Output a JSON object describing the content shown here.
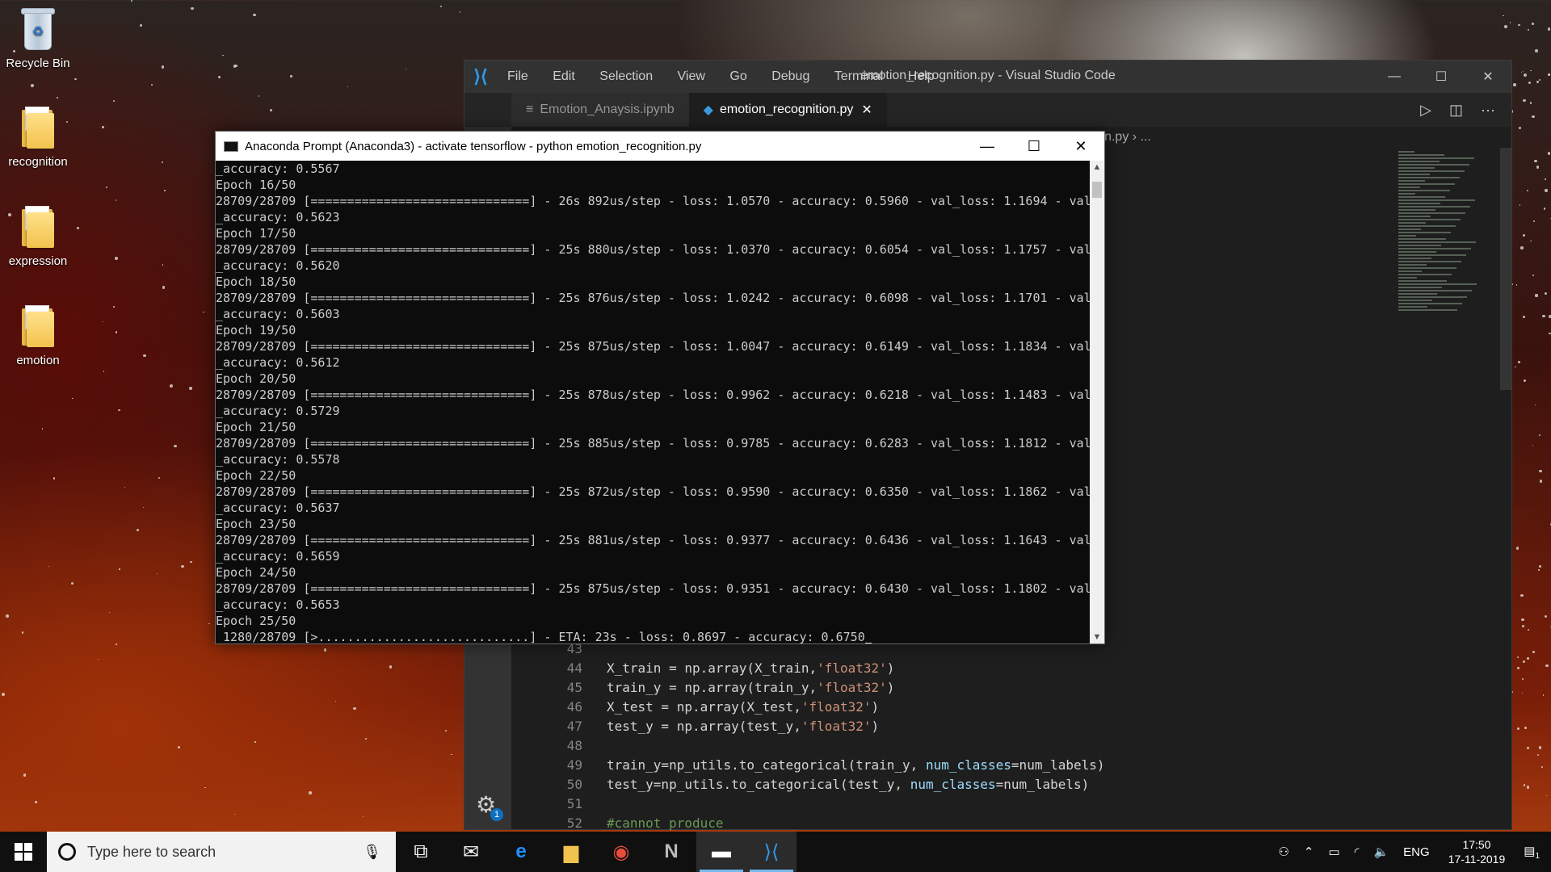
{
  "desktop": {
    "icons": [
      {
        "label": "Recycle Bin"
      },
      {
        "label": "recognition"
      },
      {
        "label": "expression"
      },
      {
        "label": "emotion"
      }
    ]
  },
  "vscode": {
    "menu": [
      "File",
      "Edit",
      "Selection",
      "View",
      "Go",
      "Debug",
      "Terminal",
      "Help"
    ],
    "window_title": "emotion_recognition.py - Visual Studio Code",
    "tabs": [
      {
        "label": "Emotion_Anaysis.ipynb",
        "icon": "notebook-icon"
      },
      {
        "label": "emotion_recognition.py",
        "icon": "python-icon",
        "close": "✕"
      }
    ],
    "breadcrumb": "tion_recognition.py  ›  ...",
    "code_lines": [
      {
        "n": "43",
        "t": ""
      },
      {
        "n": "44",
        "a": "X_train = np.array(X_train,",
        "s": "'float32'",
        "b": ")"
      },
      {
        "n": "45",
        "a": "train_y = np.array(train_y,",
        "s": "'float32'",
        "b": ")"
      },
      {
        "n": "46",
        "a": "X_test = np.array(X_test,",
        "s": "'float32'",
        "b": ")"
      },
      {
        "n": "47",
        "a": "test_y = np.array(test_y,",
        "s": "'float32'",
        "b": ")"
      },
      {
        "n": "48",
        "t": ""
      },
      {
        "n": "49",
        "a": "train_y=np_utils.to_categorical(train_y, ",
        "k": "num_classes",
        "b": "=num_labels)"
      },
      {
        "n": "50",
        "a": "test_y=np_utils.to_categorical(test_y, ",
        "k": "num_classes",
        "b": "=num_labels)"
      },
      {
        "n": "51",
        "t": ""
      },
      {
        "n": "52",
        "c": "#cannot produce"
      }
    ],
    "settings_badge": "1"
  },
  "prompt": {
    "title": "Anaconda Prompt (Anaconda3) - activate  tensorflow - python  emotion_recognition.py",
    "lines": [
      "_accuracy: 0.5567",
      "Epoch 16/50",
      "28709/28709 [==============================] - 26s 892us/step - loss: 1.0570 - accuracy: 0.5960 - val_loss: 1.1694 - val",
      "_accuracy: 0.5623",
      "Epoch 17/50",
      "28709/28709 [==============================] - 25s 880us/step - loss: 1.0370 - accuracy: 0.6054 - val_loss: 1.1757 - val",
      "_accuracy: 0.5620",
      "Epoch 18/50",
      "28709/28709 [==============================] - 25s 876us/step - loss: 1.0242 - accuracy: 0.6098 - val_loss: 1.1701 - val",
      "_accuracy: 0.5603",
      "Epoch 19/50",
      "28709/28709 [==============================] - 25s 875us/step - loss: 1.0047 - accuracy: 0.6149 - val_loss: 1.1834 - val",
      "_accuracy: 0.5612",
      "Epoch 20/50",
      "28709/28709 [==============================] - 25s 878us/step - loss: 0.9962 - accuracy: 0.6218 - val_loss: 1.1483 - val",
      "_accuracy: 0.5729",
      "Epoch 21/50",
      "28709/28709 [==============================] - 25s 885us/step - loss: 0.9785 - accuracy: 0.6283 - val_loss: 1.1812 - val",
      "_accuracy: 0.5578",
      "Epoch 22/50",
      "28709/28709 [==============================] - 25s 872us/step - loss: 0.9590 - accuracy: 0.6350 - val_loss: 1.1862 - val",
      "_accuracy: 0.5637",
      "Epoch 23/50",
      "28709/28709 [==============================] - 25s 881us/step - loss: 0.9377 - accuracy: 0.6436 - val_loss: 1.1643 - val",
      "_accuracy: 0.5659",
      "Epoch 24/50",
      "28709/28709 [==============================] - 25s 875us/step - loss: 0.9351 - accuracy: 0.6430 - val_loss: 1.1802 - val",
      "_accuracy: 0.5653",
      "Epoch 25/50",
      " 1280/28709 [>.............................] - ETA: 23s - loss: 0.8697 - accuracy: 0.6750"
    ]
  },
  "taskbar": {
    "search_placeholder": "Type here to search",
    "language": "ENG",
    "time": "17:50",
    "date": "17-11-2019",
    "notification_count": "1",
    "apps": [
      "task-view-icon",
      "mail-icon",
      "edge-icon",
      "file-explorer-icon",
      "chrome-icon",
      "app-n-icon",
      "cmd-icon",
      "vscode-icon"
    ]
  }
}
